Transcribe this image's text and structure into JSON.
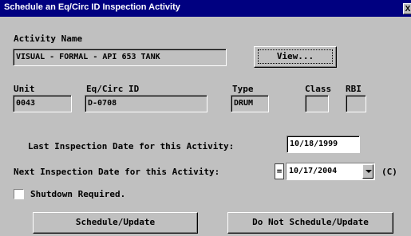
{
  "window": {
    "title": "Schedule an Eq/Circ ID Inspection Activity",
    "close_glyph": "X"
  },
  "activity": {
    "label": "Activity Name",
    "value": "VISUAL - FORMAL - API 653 TANK",
    "view_label": "View..."
  },
  "unit": {
    "label": "Unit",
    "value": "0043"
  },
  "eqcirc": {
    "label": "Eq/Circ ID",
    "value": "D-0708"
  },
  "type": {
    "label": "Type",
    "value": "DRUM"
  },
  "class": {
    "label": "Class",
    "value": ""
  },
  "rbi": {
    "label": "RBI",
    "value": ""
  },
  "last_inspection": {
    "label": "Last Inspection Date for this Activity:",
    "value": "10/18/1999"
  },
  "next_inspection": {
    "label": "Next Inspection Date for this Activity:",
    "operator": "=",
    "value": "10/17/2004",
    "suffix": "(C)"
  },
  "shutdown": {
    "label": "Shutdown Required.",
    "checked": false
  },
  "buttons": {
    "schedule": "Schedule/Update",
    "do_not_schedule": "Do Not Schedule/Update"
  }
}
